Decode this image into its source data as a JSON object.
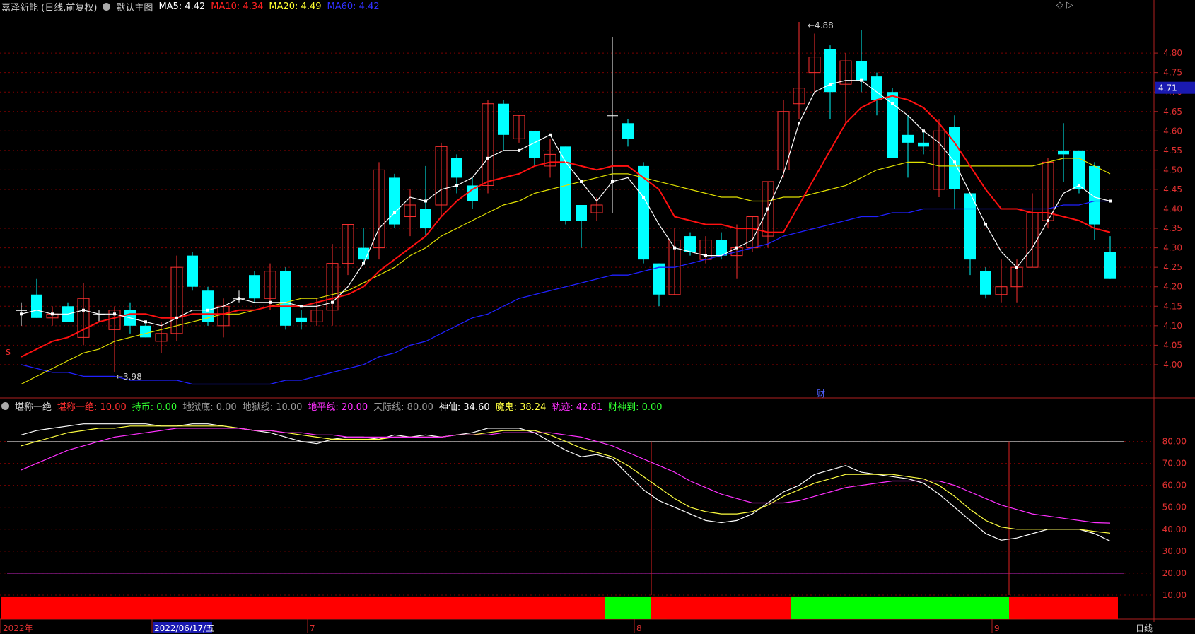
{
  "header": {
    "stock": "嘉泽新能 (日线,前复权)",
    "main_label": "默认主图",
    "ma5": "MA5: 4.42",
    "ma10": "MA10: 4.34",
    "ma20": "MA20: 4.49",
    "ma60": "MA60: 4.42",
    "right_icons": "◇ ▷"
  },
  "sub_header": {
    "name": "堪称一绝",
    "items": [
      {
        "text": "堪称一绝: 10.00",
        "color": "#ff3030"
      },
      {
        "text": "持币: 0.00",
        "color": "#30ff30"
      },
      {
        "text": "地狱底: 0.00",
        "color": "#9a9a9a"
      },
      {
        "text": "地狱线: 10.00",
        "color": "#9a9a9a"
      },
      {
        "text": "地平线: 20.00",
        "color": "#ff30ff"
      },
      {
        "text": "天际线: 80.00",
        "color": "#9a9a9a"
      },
      {
        "text": "神仙: 34.60",
        "color": "#ffffff"
      },
      {
        "text": "魔鬼: 38.24",
        "color": "#ffff40"
      },
      {
        "text": "轨迹: 42.81",
        "color": "#ff30ff"
      },
      {
        "text": "财神到: 0.00",
        "color": "#30ff30"
      }
    ]
  },
  "annotations": {
    "high": "4.88",
    "low": "3.98",
    "current_price": "4.71",
    "cai": "财",
    "s_mark": "S"
  },
  "x_labels": [
    {
      "text": "2022年",
      "i": 0
    },
    {
      "text": "2022/06/17/五",
      "i": 9
    },
    {
      "text": "7",
      "i": 19
    },
    {
      "text": "8",
      "i": 40
    },
    {
      "text": "9",
      "i": 63
    }
  ],
  "bottom_right": "日线",
  "colors": {
    "up": "#ff3030",
    "down": "#00ffff",
    "ma5": "#ffffff",
    "ma10": "#ff1010",
    "ma20": "#e0e000",
    "ma60": "#2020ff",
    "bg": "#000000",
    "grid": "#7a0000"
  },
  "chart_data": [
    {
      "type": "candlestick",
      "title": "嘉泽新能 (日线,前复权)",
      "ylim": [
        3.92,
        4.9
      ],
      "y_ticks": [
        4.0,
        4.05,
        4.1,
        4.15,
        4.2,
        4.25,
        4.3,
        4.35,
        4.4,
        4.45,
        4.5,
        4.55,
        4.6,
        4.65,
        4.7,
        4.75,
        4.8
      ],
      "candles": [
        {
          "o": 4.14,
          "h": 4.16,
          "l": 4.1,
          "c": 4.14
        },
        {
          "o": 4.18,
          "h": 4.22,
          "l": 4.12,
          "c": 4.12
        },
        {
          "o": 4.12,
          "h": 4.15,
          "l": 4.1,
          "c": 4.13
        },
        {
          "o": 4.15,
          "h": 4.16,
          "l": 4.11,
          "c": 4.11
        },
        {
          "o": 4.07,
          "h": 4.21,
          "l": 4.05,
          "c": 4.17
        },
        {
          "o": 4.13,
          "h": 4.14,
          "l": 4.11,
          "c": 4.13
        },
        {
          "o": 4.09,
          "h": 4.15,
          "l": 3.98,
          "c": 4.14
        },
        {
          "o": 4.14,
          "h": 4.16,
          "l": 4.08,
          "c": 4.1
        },
        {
          "o": 4.1,
          "h": 4.11,
          "l": 4.07,
          "c": 4.07
        },
        {
          "o": 4.06,
          "h": 4.11,
          "l": 4.03,
          "c": 4.08
        },
        {
          "o": 4.08,
          "h": 4.28,
          "l": 4.06,
          "c": 4.25
        },
        {
          "o": 4.28,
          "h": 4.29,
          "l": 4.19,
          "c": 4.2
        },
        {
          "o": 4.19,
          "h": 4.2,
          "l": 4.1,
          "c": 4.11
        },
        {
          "o": 4.1,
          "h": 4.17,
          "l": 4.07,
          "c": 4.15
        },
        {
          "o": 4.17,
          "h": 4.19,
          "l": 4.16,
          "c": 4.17
        },
        {
          "o": 4.23,
          "h": 4.24,
          "l": 4.16,
          "c": 4.17
        },
        {
          "o": 4.17,
          "h": 4.26,
          "l": 4.14,
          "c": 4.24
        },
        {
          "o": 4.24,
          "h": 4.25,
          "l": 4.09,
          "c": 4.1
        },
        {
          "o": 4.12,
          "h": 4.14,
          "l": 4.09,
          "c": 4.11
        },
        {
          "o": 4.11,
          "h": 4.17,
          "l": 4.1,
          "c": 4.14
        },
        {
          "o": 4.14,
          "h": 4.31,
          "l": 4.1,
          "c": 4.26
        },
        {
          "o": 4.26,
          "h": 4.36,
          "l": 4.23,
          "c": 4.36
        },
        {
          "o": 4.3,
          "h": 4.35,
          "l": 4.26,
          "c": 4.27
        },
        {
          "o": 4.3,
          "h": 4.52,
          "l": 4.27,
          "c": 4.5
        },
        {
          "o": 4.48,
          "h": 4.49,
          "l": 4.35,
          "c": 4.36
        },
        {
          "o": 4.38,
          "h": 4.45,
          "l": 4.33,
          "c": 4.41
        },
        {
          "o": 4.4,
          "h": 4.51,
          "l": 4.33,
          "c": 4.35
        },
        {
          "o": 4.41,
          "h": 4.57,
          "l": 4.38,
          "c": 4.56
        },
        {
          "o": 4.53,
          "h": 4.54,
          "l": 4.44,
          "c": 4.48
        },
        {
          "o": 4.46,
          "h": 4.48,
          "l": 4.4,
          "c": 4.42
        },
        {
          "o": 4.46,
          "h": 4.68,
          "l": 4.44,
          "c": 4.67
        },
        {
          "o": 4.67,
          "h": 4.68,
          "l": 4.55,
          "c": 4.59
        },
        {
          "o": 4.58,
          "h": 4.64,
          "l": 4.57,
          "c": 4.64
        },
        {
          "o": 4.6,
          "h": 4.6,
          "l": 4.51,
          "c": 4.53
        },
        {
          "o": 4.51,
          "h": 4.58,
          "l": 4.48,
          "c": 4.54
        },
        {
          "o": 4.56,
          "h": 4.56,
          "l": 4.36,
          "c": 4.37
        },
        {
          "o": 4.41,
          "h": 4.41,
          "l": 4.3,
          "c": 4.37
        },
        {
          "o": 4.39,
          "h": 4.43,
          "l": 4.37,
          "c": 4.41
        },
        {
          "o": 4.64,
          "h": 4.84,
          "l": 4.39,
          "c": 4.64
        },
        {
          "o": 4.62,
          "h": 4.63,
          "l": 4.56,
          "c": 4.58
        },
        {
          "o": 4.51,
          "h": 4.52,
          "l": 4.26,
          "c": 4.27
        },
        {
          "o": 4.26,
          "h": 4.26,
          "l": 4.15,
          "c": 4.18
        },
        {
          "o": 4.18,
          "h": 4.35,
          "l": 4.18,
          "c": 4.32
        },
        {
          "o": 4.33,
          "h": 4.34,
          "l": 4.28,
          "c": 4.29
        },
        {
          "o": 4.27,
          "h": 4.33,
          "l": 4.26,
          "c": 4.32
        },
        {
          "o": 4.32,
          "h": 4.34,
          "l": 4.27,
          "c": 4.28
        },
        {
          "o": 4.28,
          "h": 4.36,
          "l": 4.22,
          "c": 4.3
        },
        {
          "o": 4.3,
          "h": 4.38,
          "l": 4.29,
          "c": 4.38
        },
        {
          "o": 4.33,
          "h": 4.47,
          "l": 4.3,
          "c": 4.47
        },
        {
          "o": 4.5,
          "h": 4.68,
          "l": 4.48,
          "c": 4.65
        },
        {
          "o": 4.67,
          "h": 4.88,
          "l": 4.63,
          "c": 4.71
        },
        {
          "o": 4.75,
          "h": 4.85,
          "l": 4.7,
          "c": 4.79
        },
        {
          "o": 4.81,
          "h": 4.82,
          "l": 4.63,
          "c": 4.7
        },
        {
          "o": 4.72,
          "h": 4.8,
          "l": 4.62,
          "c": 4.78
        },
        {
          "o": 4.78,
          "h": 4.86,
          "l": 4.7,
          "c": 4.73
        },
        {
          "o": 4.74,
          "h": 4.75,
          "l": 4.64,
          "c": 4.68
        },
        {
          "o": 4.7,
          "h": 4.71,
          "l": 4.53,
          "c": 4.53
        },
        {
          "o": 4.59,
          "h": 4.64,
          "l": 4.48,
          "c": 4.57
        },
        {
          "o": 4.57,
          "h": 4.6,
          "l": 4.54,
          "c": 4.56
        },
        {
          "o": 4.45,
          "h": 4.63,
          "l": 4.43,
          "c": 4.6
        },
        {
          "o": 4.61,
          "h": 4.64,
          "l": 4.4,
          "c": 4.45
        },
        {
          "o": 4.44,
          "h": 4.44,
          "l": 4.23,
          "c": 4.27
        },
        {
          "o": 4.24,
          "h": 4.25,
          "l": 4.17,
          "c": 4.18
        },
        {
          "o": 4.18,
          "h": 4.27,
          "l": 4.16,
          "c": 4.2
        },
        {
          "o": 4.2,
          "h": 4.27,
          "l": 4.16,
          "c": 4.25
        },
        {
          "o": 4.25,
          "h": 4.44,
          "l": 4.25,
          "c": 4.39
        },
        {
          "o": 4.37,
          "h": 4.53,
          "l": 4.35,
          "c": 4.52
        },
        {
          "o": 4.55,
          "h": 4.62,
          "l": 4.47,
          "c": 4.54
        },
        {
          "o": 4.55,
          "h": 4.55,
          "l": 4.44,
          "c": 4.45
        },
        {
          "o": 4.51,
          "h": 4.52,
          "l": 4.32,
          "c": 4.36
        },
        {
          "o": 4.29,
          "h": 4.33,
          "l": 4.22,
          "c": 4.22
        }
      ],
      "ma5": [
        4.13,
        4.14,
        4.13,
        4.13,
        4.14,
        4.13,
        4.13,
        4.12,
        4.11,
        4.1,
        4.12,
        4.14,
        4.14,
        4.15,
        4.17,
        4.16,
        4.16,
        4.16,
        4.15,
        4.15,
        4.16,
        4.2,
        4.26,
        4.35,
        4.39,
        4.43,
        4.42,
        4.45,
        4.46,
        4.48,
        4.53,
        4.55,
        4.55,
        4.57,
        4.59,
        4.52,
        4.47,
        4.42,
        4.47,
        4.48,
        4.43,
        4.36,
        4.3,
        4.29,
        4.28,
        4.28,
        4.3,
        4.32,
        4.4,
        4.49,
        4.62,
        4.7,
        4.72,
        4.73,
        4.73,
        4.7,
        4.67,
        4.64,
        4.6,
        4.57,
        4.52,
        4.44,
        4.36,
        4.29,
        4.25,
        4.3,
        4.37,
        4.44,
        4.46,
        4.43,
        4.42
      ],
      "ma10": [
        4.02,
        4.04,
        4.06,
        4.07,
        4.09,
        4.11,
        4.12,
        4.13,
        4.13,
        4.12,
        4.12,
        4.13,
        4.13,
        4.13,
        4.14,
        4.14,
        4.15,
        4.15,
        4.15,
        4.16,
        4.17,
        4.18,
        4.2,
        4.24,
        4.27,
        4.3,
        4.33,
        4.38,
        4.42,
        4.45,
        4.47,
        4.48,
        4.49,
        4.51,
        4.52,
        4.52,
        4.51,
        4.5,
        4.51,
        4.51,
        4.48,
        4.45,
        4.38,
        4.37,
        4.36,
        4.36,
        4.35,
        4.35,
        4.34,
        4.34,
        4.41,
        4.48,
        4.55,
        4.62,
        4.66,
        4.68,
        4.69,
        4.68,
        4.66,
        4.62,
        4.57,
        4.51,
        4.45,
        4.4,
        4.4,
        4.39,
        4.39,
        4.38,
        4.37,
        4.35,
        4.34
      ],
      "ma20": [
        3.95,
        3.97,
        3.99,
        4.01,
        4.03,
        4.04,
        4.06,
        4.07,
        4.08,
        4.09,
        4.1,
        4.11,
        4.12,
        4.13,
        4.13,
        4.14,
        4.15,
        4.16,
        4.17,
        4.17,
        4.18,
        4.19,
        4.21,
        4.23,
        4.25,
        4.28,
        4.3,
        4.33,
        4.35,
        4.37,
        4.39,
        4.41,
        4.42,
        4.44,
        4.45,
        4.46,
        4.47,
        4.48,
        4.49,
        4.49,
        4.48,
        4.47,
        4.46,
        4.45,
        4.44,
        4.43,
        4.43,
        4.42,
        4.42,
        4.43,
        4.43,
        4.44,
        4.45,
        4.46,
        4.48,
        4.5,
        4.51,
        4.52,
        4.52,
        4.51,
        4.51,
        4.51,
        4.51,
        4.51,
        4.51,
        4.51,
        4.52,
        4.53,
        4.53,
        4.51,
        4.49
      ],
      "ma60": [
        4.0,
        3.99,
        3.98,
        3.98,
        3.97,
        3.97,
        3.97,
        3.96,
        3.96,
        3.96,
        3.96,
        3.95,
        3.95,
        3.95,
        3.95,
        3.95,
        3.95,
        3.96,
        3.96,
        3.97,
        3.98,
        3.99,
        4.0,
        4.02,
        4.03,
        4.05,
        4.06,
        4.08,
        4.1,
        4.12,
        4.13,
        4.15,
        4.17,
        4.18,
        4.19,
        4.2,
        4.21,
        4.22,
        4.23,
        4.23,
        4.24,
        4.25,
        4.25,
        4.26,
        4.27,
        4.28,
        4.29,
        4.3,
        4.31,
        4.33,
        4.34,
        4.35,
        4.36,
        4.37,
        4.38,
        4.38,
        4.39,
        4.39,
        4.4,
        4.4,
        4.4,
        4.4,
        4.4,
        4.4,
        4.4,
        4.4,
        4.4,
        4.41,
        4.41,
        4.42,
        4.42
      ]
    },
    {
      "type": "line",
      "title": "堪称一绝",
      "ylim": [
        0,
        95
      ],
      "y_ticks": [
        10,
        20,
        30,
        40,
        50,
        60,
        70,
        80
      ],
      "ref_lines": [
        {
          "value": 80,
          "color": "#9a9a9a"
        },
        {
          "value": 20,
          "color": "#ff30ff"
        }
      ],
      "series": [
        {
          "name": "神仙",
          "color": "#ffffff",
          "values": [
            83,
            85,
            86,
            87,
            88,
            88,
            88,
            88,
            88,
            87,
            87,
            88,
            88,
            87,
            86,
            85,
            84,
            82,
            80,
            79,
            81,
            82,
            82,
            81,
            83,
            82,
            83,
            82,
            83,
            84,
            86,
            86,
            86,
            84,
            80,
            76,
            73,
            74,
            72,
            65,
            58,
            53,
            50,
            47,
            44,
            43,
            44,
            47,
            52,
            57,
            60,
            65,
            67,
            69,
            66,
            65,
            64,
            63,
            61,
            56,
            50,
            44,
            38,
            35,
            36,
            38,
            40,
            40,
            40,
            38,
            34.6
          ]
        },
        {
          "name": "魔鬼",
          "color": "#ffff40",
          "values": [
            78,
            80,
            82,
            84,
            85,
            86,
            86,
            87,
            87,
            87,
            87,
            87,
            87,
            87,
            86,
            85,
            85,
            84,
            83,
            82,
            81,
            81,
            81,
            81,
            82,
            82,
            82,
            82,
            83,
            83,
            84,
            85,
            85,
            85,
            83,
            80,
            77,
            75,
            73,
            69,
            64,
            59,
            54,
            50,
            48,
            47,
            47,
            48,
            51,
            55,
            58,
            61,
            63,
            65,
            65,
            65,
            65,
            64,
            63,
            60,
            55,
            49,
            44,
            41,
            40,
            40,
            40,
            40,
            40,
            39,
            38.24
          ]
        },
        {
          "name": "轨迹",
          "color": "#ff30ff",
          "values": [
            67,
            70,
            73,
            76,
            78,
            80,
            82,
            83,
            84,
            85,
            86,
            86,
            86,
            86,
            86,
            85,
            85,
            84,
            84,
            83,
            83,
            82,
            82,
            82,
            82,
            82,
            82,
            82,
            83,
            83,
            83,
            84,
            84,
            84,
            84,
            83,
            82,
            80,
            78,
            75,
            72,
            69,
            66,
            62,
            59,
            56,
            54,
            52,
            52,
            52,
            53,
            55,
            57,
            59,
            60,
            61,
            62,
            62,
            62,
            62,
            60,
            57,
            54,
            51,
            49,
            47,
            46,
            45,
            44,
            43,
            42.81
          ]
        }
      ],
      "bottom_bar": [
        {
          "from": 0,
          "to": 38,
          "state": "red"
        },
        {
          "from": 38,
          "to": 41,
          "state": "green"
        },
        {
          "from": 41,
          "to": 50,
          "state": "red"
        },
        {
          "from": 50,
          "to": 64,
          "state": "green"
        },
        {
          "from": 64,
          "to": 70,
          "state": "red"
        }
      ],
      "vertical_markers": [
        41,
        64
      ]
    }
  ]
}
